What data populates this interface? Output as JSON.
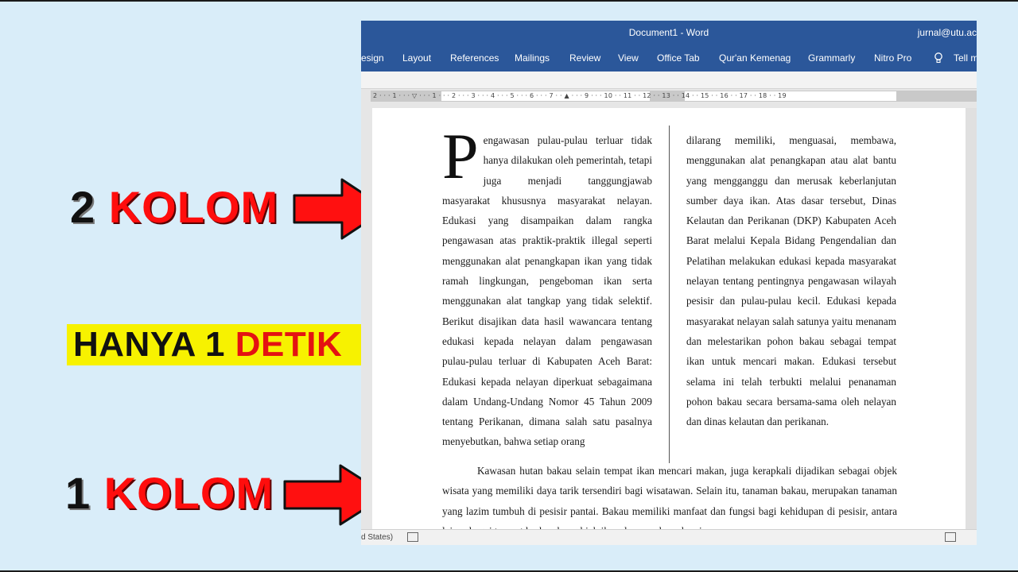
{
  "annotations": {
    "two_col": {
      "number": "2",
      "word": "KOLOM"
    },
    "banner": {
      "black": "HANYA 1",
      "red": "DETIK"
    },
    "one_col": {
      "number": "1",
      "word": "KOLOM"
    }
  },
  "window": {
    "title": "Document1  -  Word",
    "user": "jurnal@utu.ac",
    "tabs": [
      "esign",
      "Layout",
      "References",
      "Mailings",
      "Review",
      "View",
      "Office Tab",
      "Qur'an Kemenag",
      "Grammarly",
      "Nitro Pro",
      "Tell m"
    ]
  },
  "ruler": {
    "ticks": "2 · · · 1 · · · ▽ · · · 1 · · · 2 · · · 3 · · · 4 · · · 5 · · · 6 · · · 7 · · ▲ · · · 9 · · · 10 · · 11 · · 12 · · 13 · · 14 · · 15 · · 16 · · 17 · · 18 · · 19"
  },
  "document": {
    "dropcap": "P",
    "left_column": "engawasan pulau-pulau terluar tidak hanya dilakukan oleh pemerintah, tetapi juga menjadi tanggungjawab masyarakat khususnya masyarakat nelayan. Edukasi yang disampaikan dalam rangka pengawasan atas praktik-praktik illegal seperti menggunakan alat penangkapan ikan yang tidak ramah lingkungan, pengeboman ikan serta menggunakan alat tangkap yang tidak selektif. Berikut disajikan data hasil wawancara tentang edukasi kepada nelayan dalam pengawasan pulau-pulau terluar di Kabupaten Aceh Barat: Edukasi kepada nelayan diperkuat sebagaimana dalam Undang-Undang Nomor 45 Tahun 2009 tentang Perikanan, dimana salah satu pasalnya menyebutkan, bahwa setiap orang",
    "right_column": "dilarang memiliki, menguasai, membawa, menggunakan alat penangkapan atau alat bantu yang mengganggu dan merusak keberlanjutan sumber daya ikan. Atas dasar tersebut, Dinas Kelautan dan Perikanan (DKP) Kabupaten Aceh Barat melalui Kepala Bidang Pengendalian dan Pelatihan melakukan edukasi kepada masyarakat nelayan tentang pentingnya pengawasan wilayah pesisir dan pulau-pulau kecil. Edukasi kepada masyarakat nelayan salah satunya yaitu menanam dan melestarikan pohon bakau sebagai tempat ikan untuk mencari makan. Edukasi tersebut selama ini telah terbukti melalui penanaman pohon bakau secara bersama-sama oleh nelayan dan dinas kelautan dan perikanan.",
    "single_column": "Kawasan hutan bakau selain tempat ikan mencari makan, juga kerapkali dijadikan sebagai objek wisata yang memiliki daya tarik tersendiri bagi wisatawan. Selain itu, tanaman bakau, merupakan tanaman yang lazim tumbuh di pesisir pantai. Bakau memiliki manfaat dan fungsi bagi kehidupan di pesisir, antara lain sebagai tempat berkembang biak ikan dan penahan abrasi."
  },
  "status": {
    "language": "d States)"
  },
  "colors": {
    "ribbon": "#2b579a",
    "annotation_red": "#ff0d0d",
    "banner_yellow": "#f7f200",
    "background": "#d9edf9"
  }
}
